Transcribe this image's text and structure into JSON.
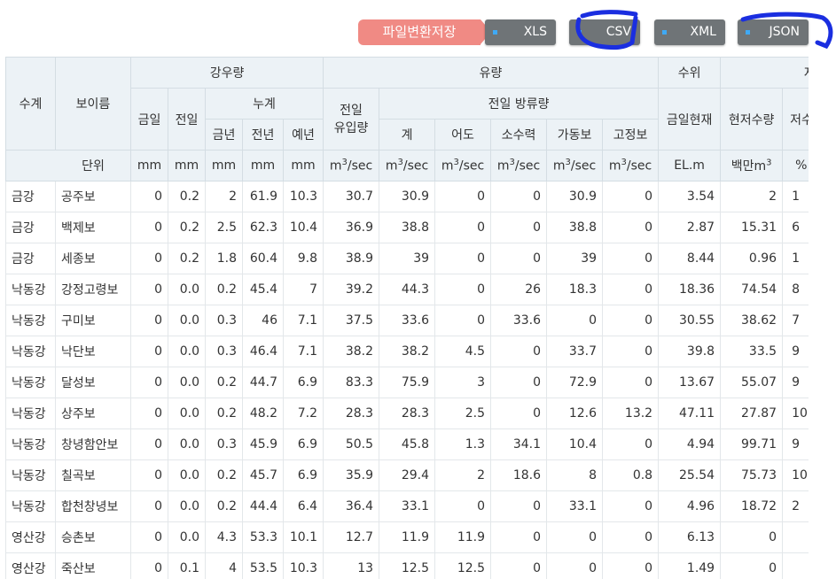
{
  "toolbar": {
    "save_label": "파일변환저장",
    "buttons": [
      {
        "label": "XLS"
      },
      {
        "label": "CSV"
      },
      {
        "label": "XML"
      },
      {
        "label": "JSON"
      }
    ],
    "button_dot_color": "#3fa9f5",
    "save_color": "#f08a84",
    "button_color": "#6f7477",
    "annotation_color": "#1a2ee0"
  },
  "table": {
    "headers": {
      "suge": "수계",
      "boname": "보이름",
      "rain": "강우량",
      "flow": "유량",
      "level": "수위",
      "storage": "저수",
      "today": "금일",
      "yesterday": "전일",
      "cumulative": "누계",
      "inflow": "전일 유입량",
      "discharge": "전일 방류량",
      "level_today": "금일현재",
      "storage_now": "현저수량",
      "storage_rate": "저수",
      "this_year": "금년",
      "last_year": "전년",
      "normal_year": "예년",
      "total": "계",
      "fishway": "어도",
      "small_hydro": "소수력",
      "movable_weir": "가동보",
      "fixed_weir": "고정보",
      "unit_label": "단위"
    },
    "units": {
      "mm": "mm",
      "m3_base": "m",
      "m3_sup": "3",
      "m3_suffix": "/sec",
      "elm": "EL.m",
      "mcm_base": "백만m",
      "mcm_sup": "3",
      "pct": "%"
    },
    "rows": [
      [
        "금강",
        "공주보",
        "0",
        "0.2",
        "2",
        "61.9",
        "10.3",
        "30.7",
        "30.9",
        "0",
        "0",
        "30.9",
        "0",
        "3.54",
        "2",
        "1"
      ],
      [
        "금강",
        "백제보",
        "0",
        "0.2",
        "2.5",
        "62.3",
        "10.4",
        "36.9",
        "38.8",
        "0",
        "0",
        "38.8",
        "0",
        "2.87",
        "15.31",
        "6"
      ],
      [
        "금강",
        "세종보",
        "0",
        "0.2",
        "1.8",
        "60.4",
        "9.8",
        "38.9",
        "39",
        "0",
        "0",
        "39",
        "0",
        "8.44",
        "0.96",
        "1"
      ],
      [
        "낙동강",
        "강정고령보",
        "0",
        "0.0",
        "0.2",
        "45.4",
        "7",
        "39.2",
        "44.3",
        "0",
        "26",
        "18.3",
        "0",
        "18.36",
        "74.54",
        "8"
      ],
      [
        "낙동강",
        "구미보",
        "0",
        "0.0",
        "0.3",
        "46",
        "7.1",
        "37.5",
        "33.6",
        "0",
        "33.6",
        "0",
        "0",
        "30.55",
        "38.62",
        "7"
      ],
      [
        "낙동강",
        "낙단보",
        "0",
        "0.0",
        "0.3",
        "46.4",
        "7.1",
        "38.2",
        "38.2",
        "4.5",
        "0",
        "33.7",
        "0",
        "39.8",
        "33.5",
        "9"
      ],
      [
        "낙동강",
        "달성보",
        "0",
        "0.0",
        "0.2",
        "44.7",
        "6.9",
        "83.3",
        "75.9",
        "3",
        "0",
        "72.9",
        "0",
        "13.67",
        "55.07",
        "9"
      ],
      [
        "낙동강",
        "상주보",
        "0",
        "0.0",
        "0.2",
        "48.2",
        "7.2",
        "28.3",
        "28.3",
        "2.5",
        "0",
        "12.6",
        "13.2",
        "47.11",
        "27.87",
        "10"
      ],
      [
        "낙동강",
        "창녕함안보",
        "0",
        "0.0",
        "0.3",
        "45.9",
        "6.9",
        "50.5",
        "45.8",
        "1.3",
        "34.1",
        "10.4",
        "0",
        "4.94",
        "99.71",
        "9"
      ],
      [
        "낙동강",
        "칠곡보",
        "0",
        "0.0",
        "0.2",
        "45.7",
        "6.9",
        "35.9",
        "29.4",
        "2",
        "18.6",
        "8",
        "0.8",
        "25.54",
        "75.73",
        "10"
      ],
      [
        "낙동강",
        "합천창녕보",
        "0",
        "0.0",
        "0.2",
        "44.4",
        "6.4",
        "36.4",
        "33.1",
        "0",
        "0",
        "33.1",
        "0",
        "4.96",
        "18.72",
        "2"
      ],
      [
        "영산강",
        "승촌보",
        "0",
        "0.0",
        "4.3",
        "53.3",
        "10.1",
        "12.7",
        "11.9",
        "11.9",
        "0",
        "0",
        "0",
        "6.13",
        "0",
        ""
      ],
      [
        "영산강",
        "죽산보",
        "0",
        "0.1",
        "4",
        "53.5",
        "10.3",
        "13",
        "12.5",
        "12.5",
        "0",
        "0",
        "0",
        "1.49",
        "0",
        ""
      ]
    ]
  }
}
